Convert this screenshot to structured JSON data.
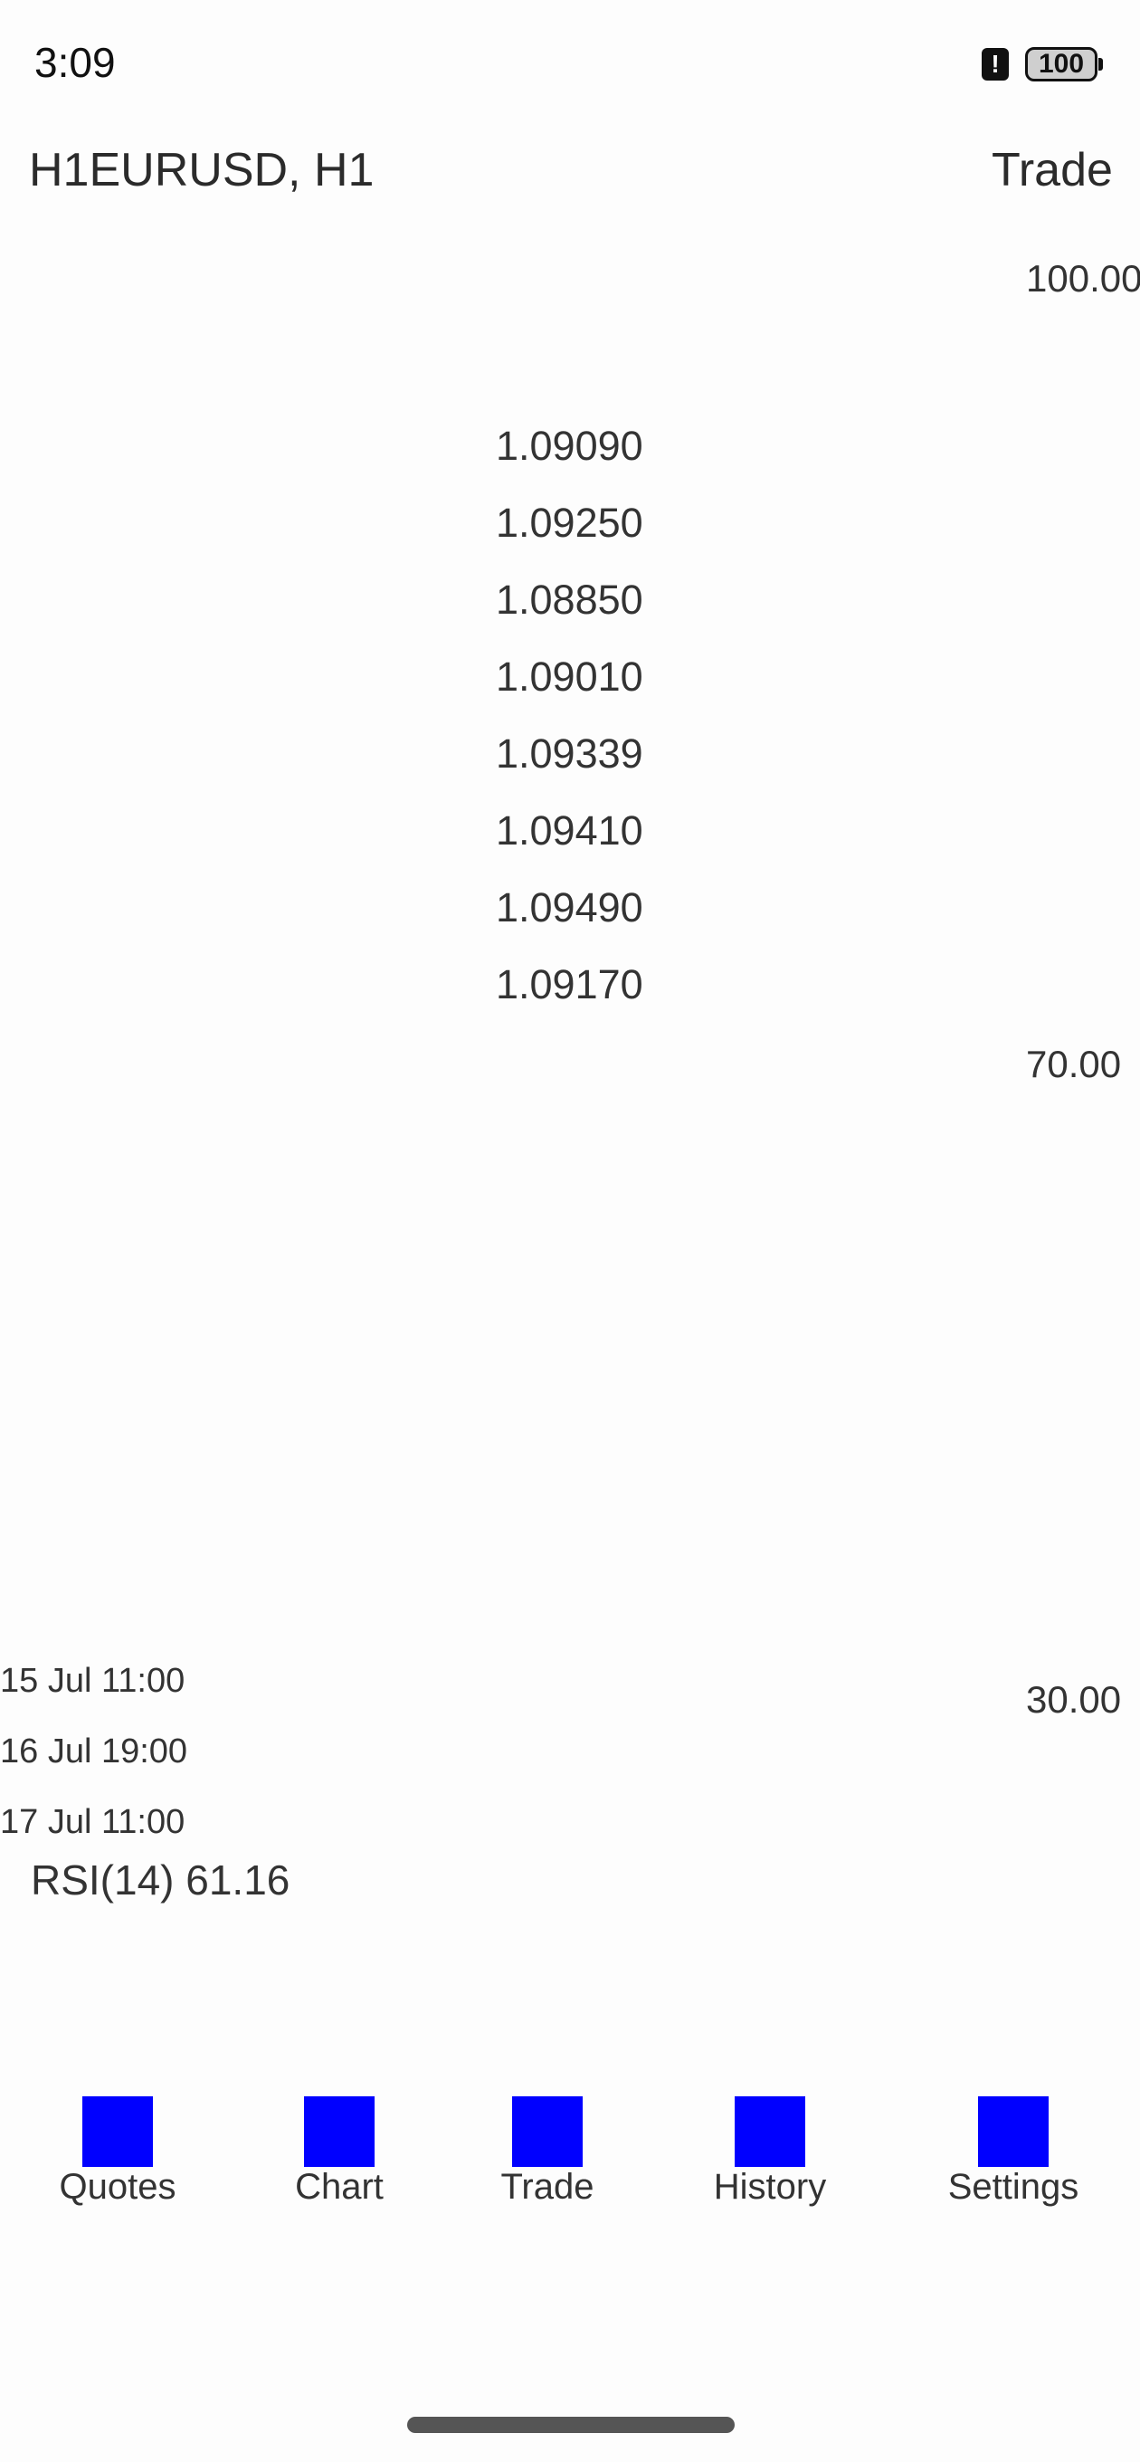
{
  "status_bar": {
    "time": "3:09",
    "alert_glyph": "!",
    "battery_level": "100"
  },
  "header": {
    "title": "H1EURUSD, H1",
    "trade_label": "Trade"
  },
  "chart": {
    "y_axis_labels": [
      "100.00",
      "70.00",
      "30.00"
    ],
    "prices": [
      "1.09090",
      "1.09250",
      "1.08850",
      "1.09010",
      "1.09339",
      "1.09410",
      "1.09490",
      "1.09170"
    ],
    "time_labels": [
      "15 Jul 11:00",
      "16 Jul 19:00",
      "17 Jul 11:00"
    ],
    "indicator": "RSI(14) 61.16"
  },
  "nav": {
    "items": [
      {
        "label": "Quotes",
        "icon": "quotes-icon",
        "color": "#0000ff"
      },
      {
        "label": "Chart",
        "icon": "chart-icon",
        "color": "#0000ff"
      },
      {
        "label": "Trade",
        "icon": "trade-icon",
        "color": "#0000ff"
      },
      {
        "label": "History",
        "icon": "history-icon",
        "color": "#0000ff"
      },
      {
        "label": "Settings",
        "icon": "settings-icon",
        "color": "#0000ff"
      }
    ]
  }
}
